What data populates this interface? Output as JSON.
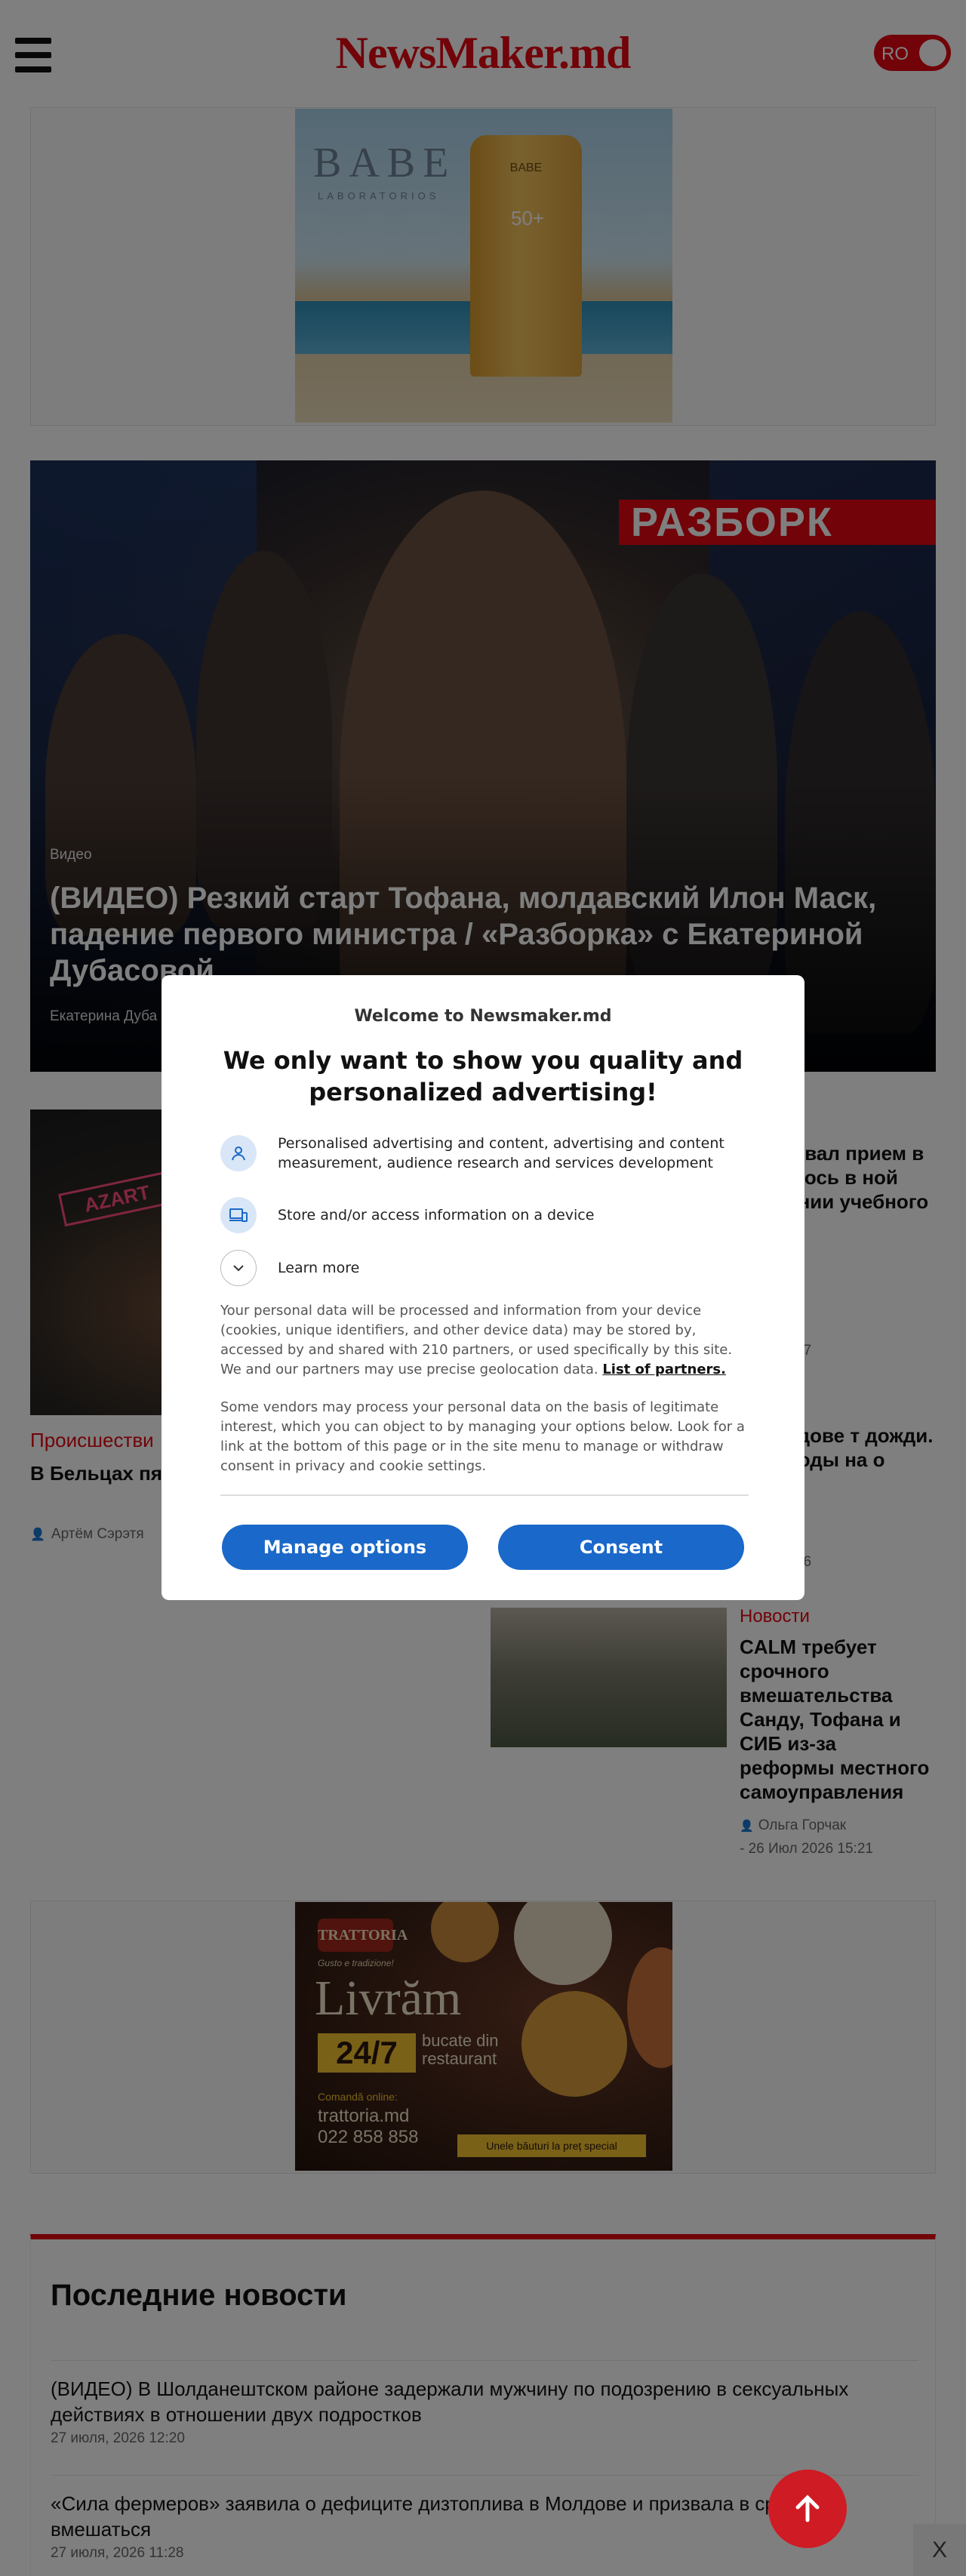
{
  "header": {
    "logo": "NewsMaker.md",
    "lang_toggle": "RO"
  },
  "ad_top": {
    "brand": "BABE",
    "sub": "LABORATORIOS",
    "tube_brand": "BABE",
    "spf": "50+"
  },
  "hero": {
    "category": "Видео",
    "title": "(ВИДЕО) Резкий старт Тофана, молдавский Илон Маск, падение первого министра / «Разборка» с Екатериной Дубасовой",
    "author": "Екатерина Дуба",
    "tag_text": "РАЗБОРК"
  },
  "articles": {
    "lead": {
      "image_sign": "AZART",
      "category": "Происшестви",
      "title": "В Бельцах пят машина. Малі",
      "author": "Артём Сэрэтя"
    },
    "side": [
      {
        "category": "и",
        "title": "лдове вал прием в Что илось в ной компании учебного",
        "author": "Сэрэтяну",
        "date": "2026 10:37"
      },
      {
        "category": "и",
        "title": "в Молдове т дожди. оз погоды на о",
        "author": "Горчак",
        "date": "2026 17:06"
      },
      {
        "category": "Новости",
        "title": "CALM требует срочного вмешательства Санду, Тофана и СИБ из-за реформы местного самоуправления",
        "author": "Ольга Горчак",
        "date": "- 26 Июл 2026 15:21"
      }
    ]
  },
  "ad_bottom": {
    "badge": "TRATTORIA",
    "tagline": "Gusto e tradizione!",
    "headline": "Livrăm",
    "hours": "24/7",
    "sub": "bucate din restaurant",
    "online_label": "Comandă online:",
    "url": "trattoria.md",
    "phone": "022 858 858",
    "ribbon": "Unele băuturi la preț special"
  },
  "latest": {
    "heading": "Последние новости",
    "items": [
      {
        "title": "(ВИДЕО) В Шолданештском районе задержали мужчину по подозрению в сексуальных действиях в отношении двух подростков",
        "date": "27 июля, 2026 12:20"
      },
      {
        "title": "«Сила фермеров» заявила о дефиците дизтоплива в Молдове и призвала в срочно вмешаться",
        "date": "27 июля, 2026 11:28"
      }
    ]
  },
  "consent": {
    "welcome": "Welcome to Newsmaker.md",
    "headline": "We only want to show you quality and personalized advertising!",
    "purpose_1": "Personalised advertising and content, advertising and content measurement, audience research and services development",
    "purpose_2": "Store and/or access information on a device",
    "learn_more": "Learn more",
    "body_1": "Your personal data will be processed and information from your device (cookies, unique identifiers, and other device data) may be stored by, accessed by and shared with 210 partners, or used specifically by this site. We and our partners may use precise geolocation data.",
    "partners_link": "List of partners.",
    "body_2": "Some vendors may process your personal data on the basis of legitimate interest, which you can object to by managing your options below. Look for a link at the bottom of this page or in the site menu to manage or withdraw consent in privacy and cookie settings.",
    "manage_button": "Manage options",
    "consent_button": "Consent"
  },
  "floating": {
    "close": "X"
  },
  "colors": {
    "brand_red": "#e30613",
    "button_blue": "#1a68c9",
    "overlay": "rgba(0,0,0,0.5)"
  },
  "icons": {
    "menu": "hamburger-menu-icon",
    "user": "person-icon",
    "device": "devices-icon",
    "learn_more": "chevron-down-icon",
    "scroll_top": "arrow-up-icon",
    "author": "person-icon"
  }
}
